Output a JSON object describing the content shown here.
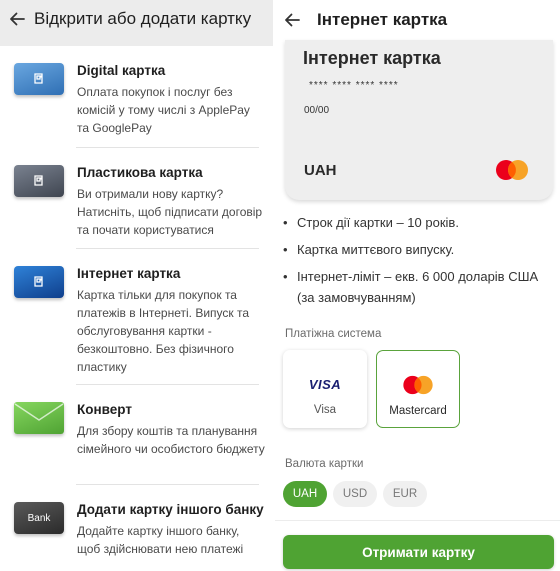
{
  "left": {
    "title": "Відкрити або додати картку",
    "items": [
      {
        "title": "Digital картка",
        "description": "Оплата покупок і послуг без комісій у тому числі з ApplePay та GooglePay",
        "icon": "digital-card-icon",
        "color": "#3d82c8"
      },
      {
        "title": "Пластикова картка",
        "description": "Ви отримали нову картку? Натисніть, щоб підписати договір та почати користуватися",
        "icon": "plastic-card-icon",
        "color": "#4c5360"
      },
      {
        "title": "Інтернет картка",
        "description": "Картка тільки для покупок та платежів в Інтернеті. Випуск та обслуговування картки - безкоштовно. Без фізичного пластику",
        "icon": "internet-card-icon",
        "color": "#1e5fb3"
      },
      {
        "title": "Конверт",
        "description": "Для збору коштів та планування сімейного чи особистого бюджету",
        "icon": "envelope-icon",
        "color": "#6cc24a"
      },
      {
        "title": "Додати картку іншого банку",
        "description": "Додайте картку іншого банку, щоб здійснювати нею платежі",
        "icon": "bank-card-icon",
        "color": "#3f3f3f",
        "thumb_label": "Bank"
      }
    ]
  },
  "right": {
    "title": "Інтернет картка",
    "card": {
      "title": "Інтернет картка",
      "number": "****  ****  ****  ****",
      "expiry": "00/00",
      "currency": "UAH"
    },
    "features": [
      "Строк дії картки – 10 років.",
      "Картка миттєвого випуску.",
      "Інтернет-ліміт – екв. 6 000 доларів США (за замовчуванням)"
    ],
    "payment_system_label": "Платіжна система",
    "payment_systems": [
      {
        "label": "Visa",
        "logo_text": "VISA",
        "selected": false
      },
      {
        "label": "Mastercard",
        "selected": true
      }
    ],
    "currency_label": "Валюта картки",
    "currencies": [
      {
        "label": "UAH",
        "selected": true
      },
      {
        "label": "USD",
        "selected": false
      },
      {
        "label": "EUR",
        "selected": false
      }
    ],
    "cta_label": "Отримати картку"
  },
  "colors": {
    "accent": "#4fa333",
    "mastercard_red": "#eb001b",
    "mastercard_orange": "#f79e1b"
  }
}
